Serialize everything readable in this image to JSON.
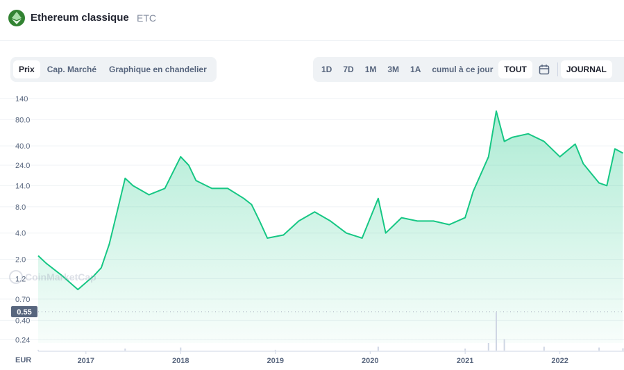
{
  "header": {
    "coin_name": "Ethereum classique",
    "coin_symbol": "ETC"
  },
  "tabs_left": [
    {
      "label": "Prix",
      "active": true
    },
    {
      "label": "Cap. Marché",
      "active": false
    },
    {
      "label": "Graphique en chandelier",
      "active": false
    }
  ],
  "tabs_right": [
    {
      "label": "1D",
      "active": false
    },
    {
      "label": "7D",
      "active": false
    },
    {
      "label": "1M",
      "active": false
    },
    {
      "label": "3M",
      "active": false
    },
    {
      "label": "1A",
      "active": false
    },
    {
      "label": "cumul à ce jour",
      "active": false
    },
    {
      "label": "TOUT",
      "active": true
    }
  ],
  "journal_label": "JOURNAL",
  "icons": {
    "calendar": "calendar-icon",
    "logo": "ethereum-classic-logo-icon",
    "watermark": "coinmarketcap-watermark"
  },
  "watermark_text": "CoinMarketCap",
  "colors": {
    "line": "#16c784",
    "current_price_badge": "#58667e",
    "volume": "#cfd6e4"
  },
  "chart_data": {
    "type": "area",
    "y_scale": "log",
    "currency_label": "EUR",
    "y_ticks": [
      "140",
      "80.0",
      "40.0",
      "24.0",
      "14.0",
      "8.0",
      "4.0",
      "2.0",
      "1.2",
      "0.70",
      "0.40",
      "0.24"
    ],
    "current_price_label": "0.55",
    "x_ticks": [
      "2017",
      "2018",
      "2019",
      "2020",
      "2021",
      "2022"
    ],
    "series": [
      {
        "x": [
          "2016-07",
          "2016-08",
          "2016-10",
          "2016-12",
          "2017-02",
          "2017-03",
          "2017-04",
          "2017-05",
          "2017-06",
          "2017-07",
          "2017-09",
          "2017-11",
          "2018-01",
          "2018-02",
          "2018-03",
          "2018-05",
          "2018-07",
          "2018-09",
          "2018-10",
          "2018-11",
          "2018-12",
          "2019-02",
          "2019-04",
          "2019-06",
          "2019-08",
          "2019-10",
          "2019-12",
          "2020-02",
          "2020-03",
          "2020-05",
          "2020-07",
          "2020-09",
          "2020-11",
          "2021-01",
          "2021-02",
          "2021-04",
          "2021-05",
          "2021-06",
          "2021-07",
          "2021-09",
          "2021-11",
          "2022-01",
          "2022-03",
          "2022-04",
          "2022-06",
          "2022-07",
          "2022-08",
          "2022-09"
        ],
        "values": [
          2.2,
          1.8,
          1.3,
          0.9,
          1.3,
          1.6,
          3.0,
          7.0,
          17.0,
          14.0,
          11.0,
          13.0,
          30.0,
          24.0,
          16.0,
          13.0,
          13.0,
          10.0,
          8.5,
          5.5,
          3.5,
          3.8,
          5.5,
          7.0,
          5.5,
          4.0,
          3.5,
          10.0,
          4.0,
          6.0,
          5.5,
          5.5,
          5.0,
          6.0,
          12.0,
          30.0,
          100.0,
          45.0,
          50.0,
          55.0,
          45.0,
          30.0,
          42.0,
          25.0,
          15.0,
          14.0,
          37.0,
          33.0
        ]
      }
    ],
    "volume": {
      "x": [
        "2016-07",
        "2017-06",
        "2018-01",
        "2019-01",
        "2020-02",
        "2021-01",
        "2021-04",
        "2021-05",
        "2021-06",
        "2021-11",
        "2022-06",
        "2022-09"
      ],
      "values": [
        0.02,
        0.05,
        0.08,
        0.02,
        0.1,
        0.05,
        0.2,
        1.0,
        0.3,
        0.1,
        0.08,
        0.06
      ]
    }
  }
}
